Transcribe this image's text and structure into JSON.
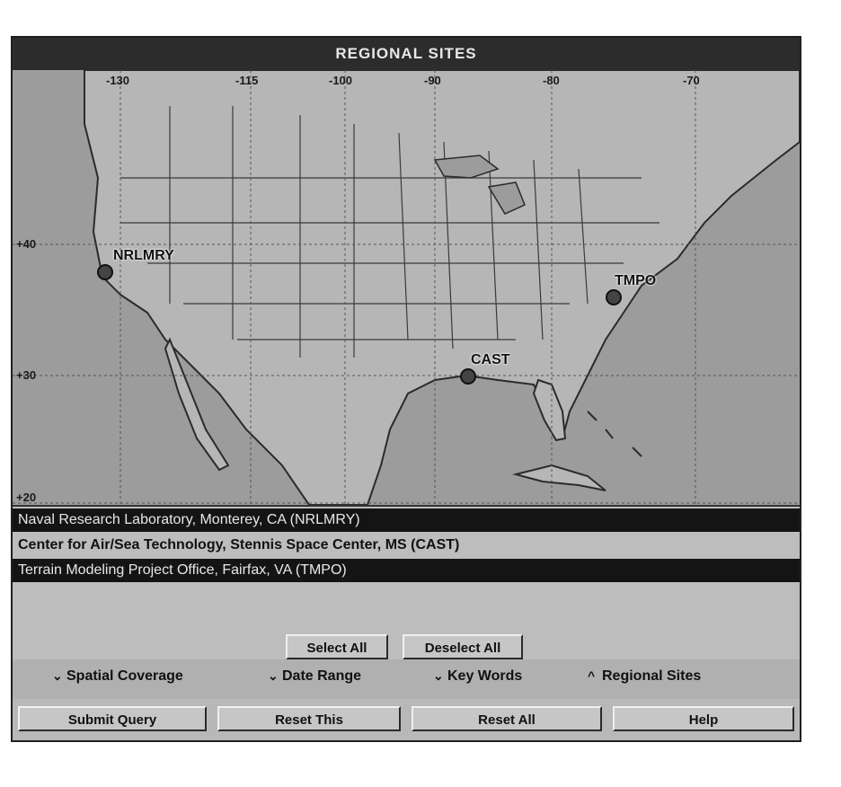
{
  "window": {
    "title": "REGIONAL SITES"
  },
  "map": {
    "longitude_labels": [
      "-130",
      "-115",
      "-100",
      "-90",
      "-80",
      "-70"
    ],
    "latitude_labels": [
      "+40",
      "+30",
      "+20"
    ],
    "sites": [
      {
        "code": "NRLMRY"
      },
      {
        "code": "TMPO"
      },
      {
        "code": "CAST"
      }
    ]
  },
  "site_list": {
    "items": [
      {
        "label": "Naval Research Laboratory, Monterey, CA (NRLMRY)",
        "selected": true
      },
      {
        "label": "Center for Air/Sea Technology,  Stennis Space Center, MS (CAST)",
        "selected": false
      },
      {
        "label": "Terrain Modeling Project Office, Fairfax, VA (TMPO)",
        "selected": true
      }
    ],
    "select_all_label": "Select All",
    "deselect_all_label": "Deselect All"
  },
  "options": [
    {
      "label": "Spatial Coverage",
      "mark": "⌄"
    },
    {
      "label": "Date Range",
      "mark": "⌄"
    },
    {
      "label": "Key Words",
      "mark": "⌄"
    },
    {
      "label": "Regional Sites",
      "mark": "^"
    }
  ],
  "actions": {
    "submit_label": "Submit Query",
    "reset_this_label": "Reset This",
    "reset_all_label": "Reset All",
    "help_label": "Help"
  },
  "colors": {
    "titlebar": "#2c2c2c",
    "selection": "#141414",
    "panel": "#b8b8b8"
  }
}
